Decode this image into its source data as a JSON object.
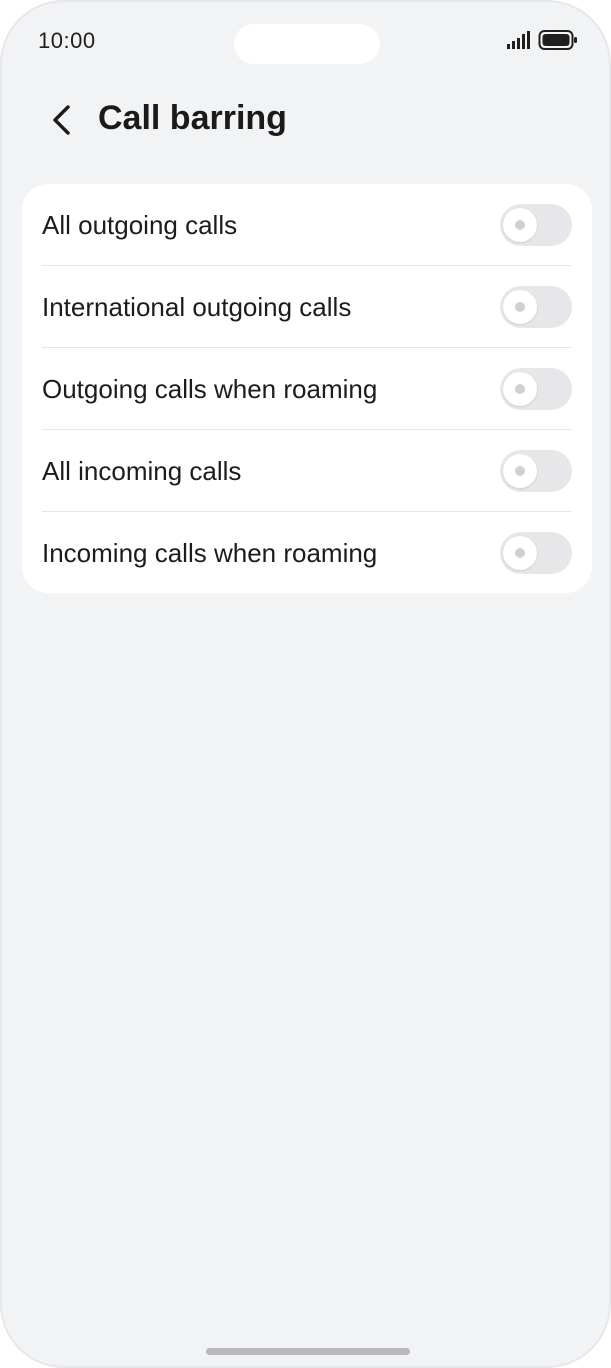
{
  "status_bar": {
    "time": "10:00",
    "signal_icon": "cellular-signal-icon",
    "battery_icon": "battery-full-icon"
  },
  "header": {
    "back_icon": "chevron-left-icon",
    "title": "Call barring"
  },
  "settings": [
    {
      "label": "All outgoing calls",
      "enabled": false
    },
    {
      "label": "International outgoing calls",
      "enabled": false
    },
    {
      "label": "Outgoing calls when roaming",
      "enabled": false
    },
    {
      "label": "All incoming calls",
      "enabled": false
    },
    {
      "label": "Incoming calls when roaming",
      "enabled": false
    }
  ],
  "colors": {
    "background": "#f2f3f5",
    "card": "#ffffff",
    "toggle_off": "#e7e7e9",
    "text": "#1c1c1c"
  }
}
